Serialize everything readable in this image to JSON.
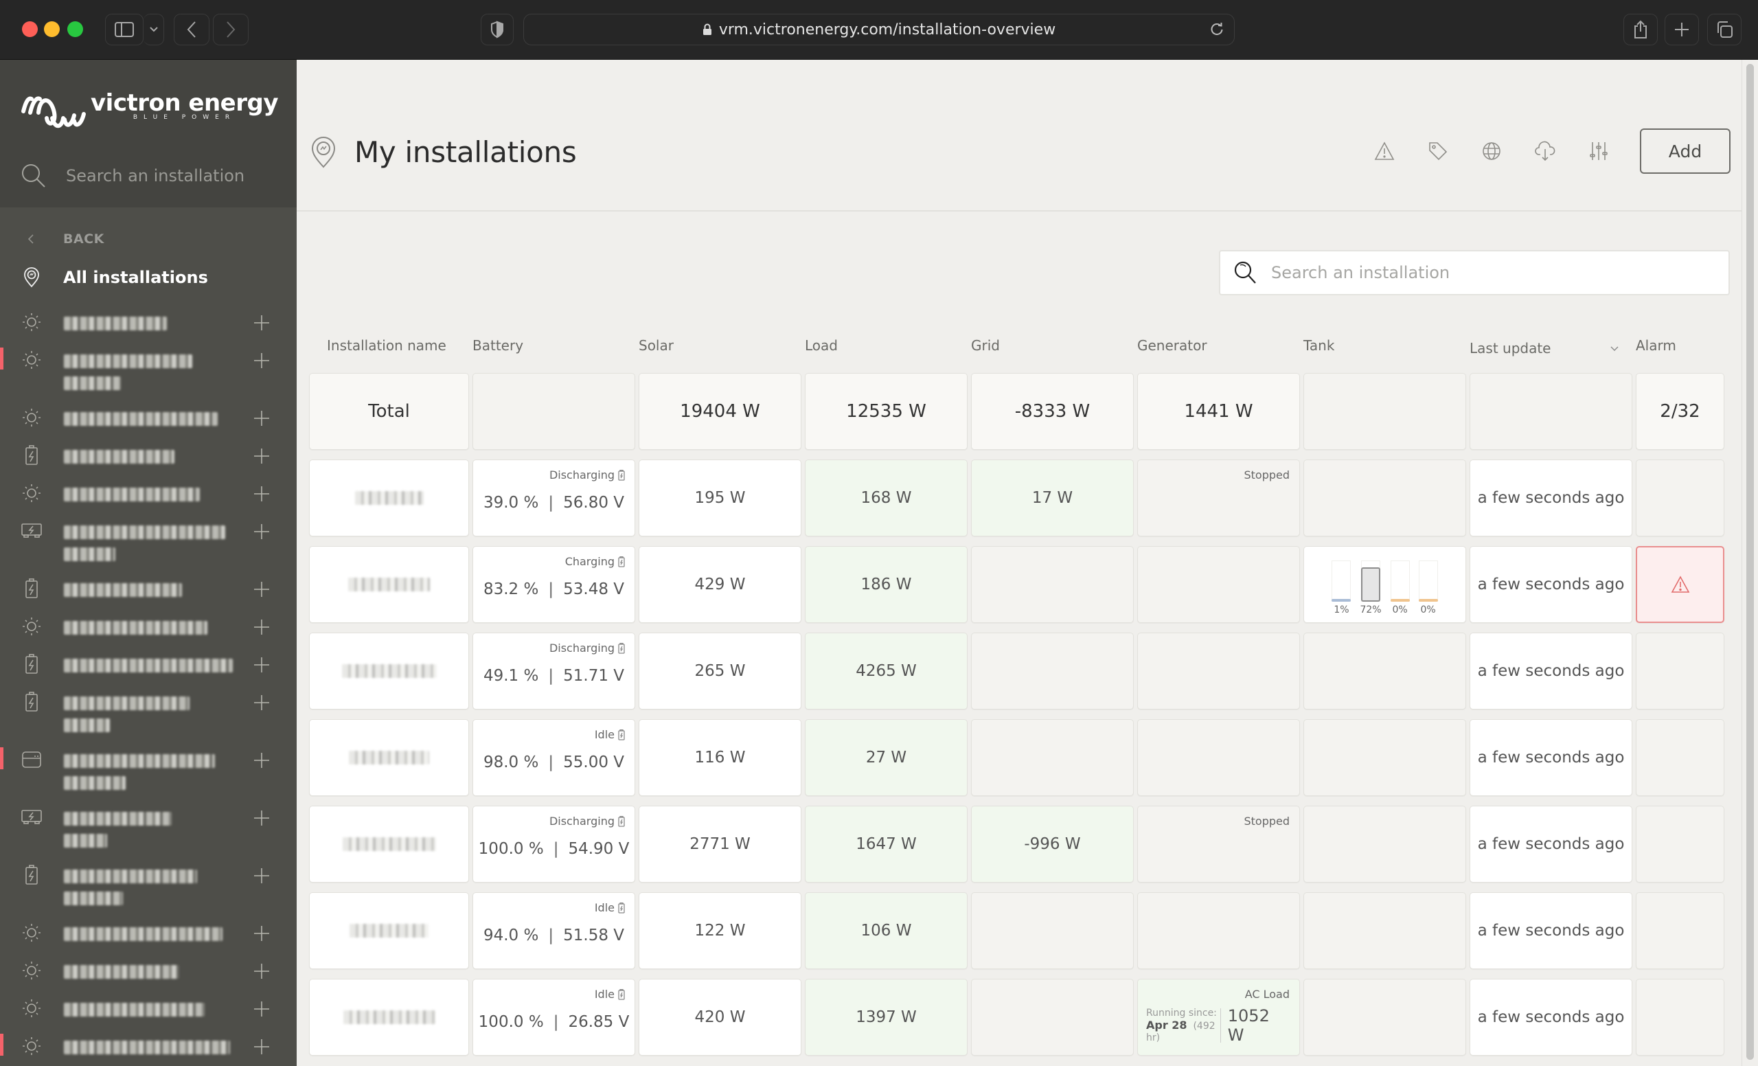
{
  "browser": {
    "url": "vrm.victronenergy.com/installation-overview"
  },
  "sidebar": {
    "logo_name": "victron energy",
    "logo_tagline": "BLUE POWER",
    "search_placeholder": "Search an installation",
    "back_label": "BACK",
    "all_installations_label": "All installations",
    "items": [
      {
        "icon": "sun-icon",
        "obscured": true,
        "lines": 1,
        "alarm": false
      },
      {
        "icon": "sun-icon",
        "obscured": true,
        "lines": 2,
        "alarm": true
      },
      {
        "icon": "sun-icon",
        "obscured": true,
        "lines": 1,
        "alarm": false
      },
      {
        "icon": "battery-icon",
        "obscured": true,
        "lines": 1,
        "alarm": false
      },
      {
        "icon": "sun-icon",
        "obscured": true,
        "lines": 1,
        "alarm": false
      },
      {
        "icon": "inverter-icon",
        "obscured": true,
        "lines": 2,
        "alarm": false
      },
      {
        "icon": "battery-icon",
        "obscured": true,
        "lines": 1,
        "alarm": false
      },
      {
        "icon": "sun-icon",
        "obscured": true,
        "lines": 1,
        "alarm": false
      },
      {
        "icon": "battery-icon",
        "obscured": true,
        "lines": 1,
        "alarm": false
      },
      {
        "icon": "battery-icon",
        "obscured": true,
        "lines": 2,
        "alarm": false
      },
      {
        "icon": "device-icon",
        "obscured": true,
        "lines": 2,
        "alarm": true
      },
      {
        "icon": "inverter-icon",
        "obscured": true,
        "lines": 2,
        "alarm": false
      },
      {
        "icon": "battery-icon",
        "obscured": true,
        "lines": 2,
        "alarm": false
      },
      {
        "icon": "sun-icon",
        "obscured": true,
        "lines": 1,
        "alarm": false
      },
      {
        "icon": "sun-icon",
        "obscured": true,
        "lines": 1,
        "alarm": false
      },
      {
        "icon": "sun-icon",
        "obscured": true,
        "lines": 1,
        "alarm": false
      },
      {
        "icon": "sun-icon",
        "obscured": true,
        "lines": 1,
        "alarm": true
      }
    ]
  },
  "header": {
    "title": "My installations",
    "tools": [
      "alarm-icon",
      "tag-icon",
      "globe-icon",
      "cloud-download-icon",
      "filter-sliders-icon"
    ],
    "add_label": "Add"
  },
  "search": {
    "placeholder": "Search an installation"
  },
  "table": {
    "columns": [
      "Installation name",
      "Battery",
      "Solar",
      "Load",
      "Grid",
      "Generator",
      "Tank",
      "Last update",
      "Alarm"
    ],
    "sorted_column": "Last update",
    "total": {
      "label": "Total",
      "battery": "",
      "solar": "19404 W",
      "load": "12535 W",
      "grid": "-8333 W",
      "generator": "1441 W",
      "tank": "",
      "last_update": "",
      "alarm": "2/32"
    },
    "rows": [
      {
        "name_obscured": true,
        "battery_status": "Discharging",
        "soc": "39.0 %",
        "voltage": "56.80 V",
        "solar": "195 W",
        "load": "168 W",
        "grid": "17 W",
        "generator_status": "Stopped",
        "tank": null,
        "last_update": "a few seconds ago",
        "alarm": false
      },
      {
        "name_obscured": true,
        "battery_status": "Charging",
        "soc": "83.2 %",
        "voltage": "53.48 V",
        "solar": "429 W",
        "load": "186 W",
        "grid": "",
        "generator_status": "",
        "tank": [
          {
            "percent": 1,
            "label": "1%",
            "color": "#a9bcd6"
          },
          {
            "percent": 72,
            "label": "72%",
            "color": "#e6e6e6"
          },
          {
            "percent": 0,
            "label": "0%",
            "color": "#f0c48e"
          },
          {
            "percent": 0,
            "label": "0%",
            "color": "#f0c48e"
          }
        ],
        "last_update": "a few seconds ago",
        "alarm": true
      },
      {
        "name_obscured": true,
        "battery_status": "Discharging",
        "soc": "49.1 %",
        "voltage": "51.71 V",
        "solar": "265 W",
        "load": "4265 W",
        "grid": "",
        "generator_status": "",
        "tank": null,
        "last_update": "a few seconds ago",
        "alarm": false
      },
      {
        "name_obscured": true,
        "battery_status": "Idle",
        "soc": "98.0 %",
        "voltage": "55.00 V",
        "solar": "116 W",
        "load": "27 W",
        "grid": "",
        "generator_status": "",
        "tank": null,
        "last_update": "a few seconds ago",
        "alarm": false
      },
      {
        "name_obscured": true,
        "battery_status": "Discharging",
        "soc": "100.0 %",
        "voltage": "54.90 V",
        "solar": "2771 W",
        "load": "1647 W",
        "grid": "-996 W",
        "generator_status": "Stopped",
        "tank": null,
        "last_update": "a few seconds ago",
        "alarm": false
      },
      {
        "name_obscured": true,
        "battery_status": "Idle",
        "soc": "94.0 %",
        "voltage": "51.58 V",
        "solar": "122 W",
        "load": "106 W",
        "grid": "",
        "generator_status": "",
        "tank": null,
        "last_update": "a few seconds ago",
        "alarm": false
      },
      {
        "name_obscured": true,
        "battery_status": "Idle",
        "soc": "100.0 %",
        "voltage": "26.85 V",
        "solar": "420 W",
        "load": "1397 W",
        "grid": "",
        "generator_status": "AC Load",
        "generator_running": {
          "label": "Running since:",
          "date": "Apr 28",
          "duration": "(492 hr)",
          "value": "1052 W"
        },
        "tank": null,
        "last_update": "a few seconds ago",
        "alarm": false
      }
    ]
  },
  "colors": {
    "sidebar_bg": "#4e4e49",
    "sidebar_top_bg": "#444440",
    "main_bg": "#f0efec",
    "alarm_red": "#f4626a",
    "green_cell": "#f1f8ee"
  }
}
